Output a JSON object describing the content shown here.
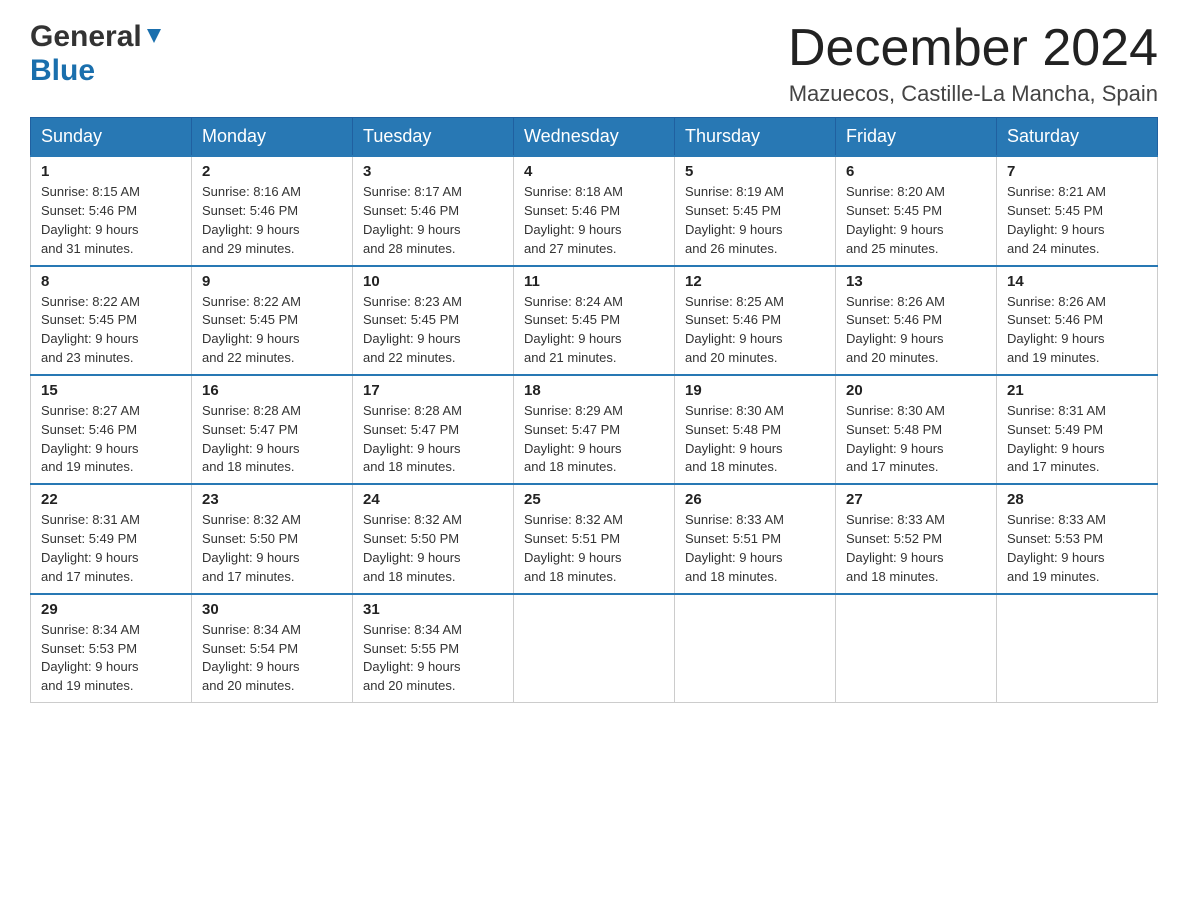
{
  "header": {
    "logo_general": "General",
    "logo_blue": "Blue",
    "month_title": "December 2024",
    "location": "Mazuecos, Castille-La Mancha, Spain"
  },
  "weekdays": [
    "Sunday",
    "Monday",
    "Tuesday",
    "Wednesday",
    "Thursday",
    "Friday",
    "Saturday"
  ],
  "weeks": [
    [
      {
        "day": "1",
        "sunrise": "8:15 AM",
        "sunset": "5:46 PM",
        "daylight": "9 hours and 31 minutes."
      },
      {
        "day": "2",
        "sunrise": "8:16 AM",
        "sunset": "5:46 PM",
        "daylight": "9 hours and 29 minutes."
      },
      {
        "day": "3",
        "sunrise": "8:17 AM",
        "sunset": "5:46 PM",
        "daylight": "9 hours and 28 minutes."
      },
      {
        "day": "4",
        "sunrise": "8:18 AM",
        "sunset": "5:46 PM",
        "daylight": "9 hours and 27 minutes."
      },
      {
        "day": "5",
        "sunrise": "8:19 AM",
        "sunset": "5:45 PM",
        "daylight": "9 hours and 26 minutes."
      },
      {
        "day": "6",
        "sunrise": "8:20 AM",
        "sunset": "5:45 PM",
        "daylight": "9 hours and 25 minutes."
      },
      {
        "day": "7",
        "sunrise": "8:21 AM",
        "sunset": "5:45 PM",
        "daylight": "9 hours and 24 minutes."
      }
    ],
    [
      {
        "day": "8",
        "sunrise": "8:22 AM",
        "sunset": "5:45 PM",
        "daylight": "9 hours and 23 minutes."
      },
      {
        "day": "9",
        "sunrise": "8:22 AM",
        "sunset": "5:45 PM",
        "daylight": "9 hours and 22 minutes."
      },
      {
        "day": "10",
        "sunrise": "8:23 AM",
        "sunset": "5:45 PM",
        "daylight": "9 hours and 22 minutes."
      },
      {
        "day": "11",
        "sunrise": "8:24 AM",
        "sunset": "5:45 PM",
        "daylight": "9 hours and 21 minutes."
      },
      {
        "day": "12",
        "sunrise": "8:25 AM",
        "sunset": "5:46 PM",
        "daylight": "9 hours and 20 minutes."
      },
      {
        "day": "13",
        "sunrise": "8:26 AM",
        "sunset": "5:46 PM",
        "daylight": "9 hours and 20 minutes."
      },
      {
        "day": "14",
        "sunrise": "8:26 AM",
        "sunset": "5:46 PM",
        "daylight": "9 hours and 19 minutes."
      }
    ],
    [
      {
        "day": "15",
        "sunrise": "8:27 AM",
        "sunset": "5:46 PM",
        "daylight": "9 hours and 19 minutes."
      },
      {
        "day": "16",
        "sunrise": "8:28 AM",
        "sunset": "5:47 PM",
        "daylight": "9 hours and 18 minutes."
      },
      {
        "day": "17",
        "sunrise": "8:28 AM",
        "sunset": "5:47 PM",
        "daylight": "9 hours and 18 minutes."
      },
      {
        "day": "18",
        "sunrise": "8:29 AM",
        "sunset": "5:47 PM",
        "daylight": "9 hours and 18 minutes."
      },
      {
        "day": "19",
        "sunrise": "8:30 AM",
        "sunset": "5:48 PM",
        "daylight": "9 hours and 18 minutes."
      },
      {
        "day": "20",
        "sunrise": "8:30 AM",
        "sunset": "5:48 PM",
        "daylight": "9 hours and 17 minutes."
      },
      {
        "day": "21",
        "sunrise": "8:31 AM",
        "sunset": "5:49 PM",
        "daylight": "9 hours and 17 minutes."
      }
    ],
    [
      {
        "day": "22",
        "sunrise": "8:31 AM",
        "sunset": "5:49 PM",
        "daylight": "9 hours and 17 minutes."
      },
      {
        "day": "23",
        "sunrise": "8:32 AM",
        "sunset": "5:50 PM",
        "daylight": "9 hours and 17 minutes."
      },
      {
        "day": "24",
        "sunrise": "8:32 AM",
        "sunset": "5:50 PM",
        "daylight": "9 hours and 18 minutes."
      },
      {
        "day": "25",
        "sunrise": "8:32 AM",
        "sunset": "5:51 PM",
        "daylight": "9 hours and 18 minutes."
      },
      {
        "day": "26",
        "sunrise": "8:33 AM",
        "sunset": "5:51 PM",
        "daylight": "9 hours and 18 minutes."
      },
      {
        "day": "27",
        "sunrise": "8:33 AM",
        "sunset": "5:52 PM",
        "daylight": "9 hours and 18 minutes."
      },
      {
        "day": "28",
        "sunrise": "8:33 AM",
        "sunset": "5:53 PM",
        "daylight": "9 hours and 19 minutes."
      }
    ],
    [
      {
        "day": "29",
        "sunrise": "8:34 AM",
        "sunset": "5:53 PM",
        "daylight": "9 hours and 19 minutes."
      },
      {
        "day": "30",
        "sunrise": "8:34 AM",
        "sunset": "5:54 PM",
        "daylight": "9 hours and 20 minutes."
      },
      {
        "day": "31",
        "sunrise": "8:34 AM",
        "sunset": "5:55 PM",
        "daylight": "9 hours and 20 minutes."
      },
      null,
      null,
      null,
      null
    ]
  ],
  "labels": {
    "sunrise": "Sunrise:",
    "sunset": "Sunset:",
    "daylight": "Daylight:"
  }
}
